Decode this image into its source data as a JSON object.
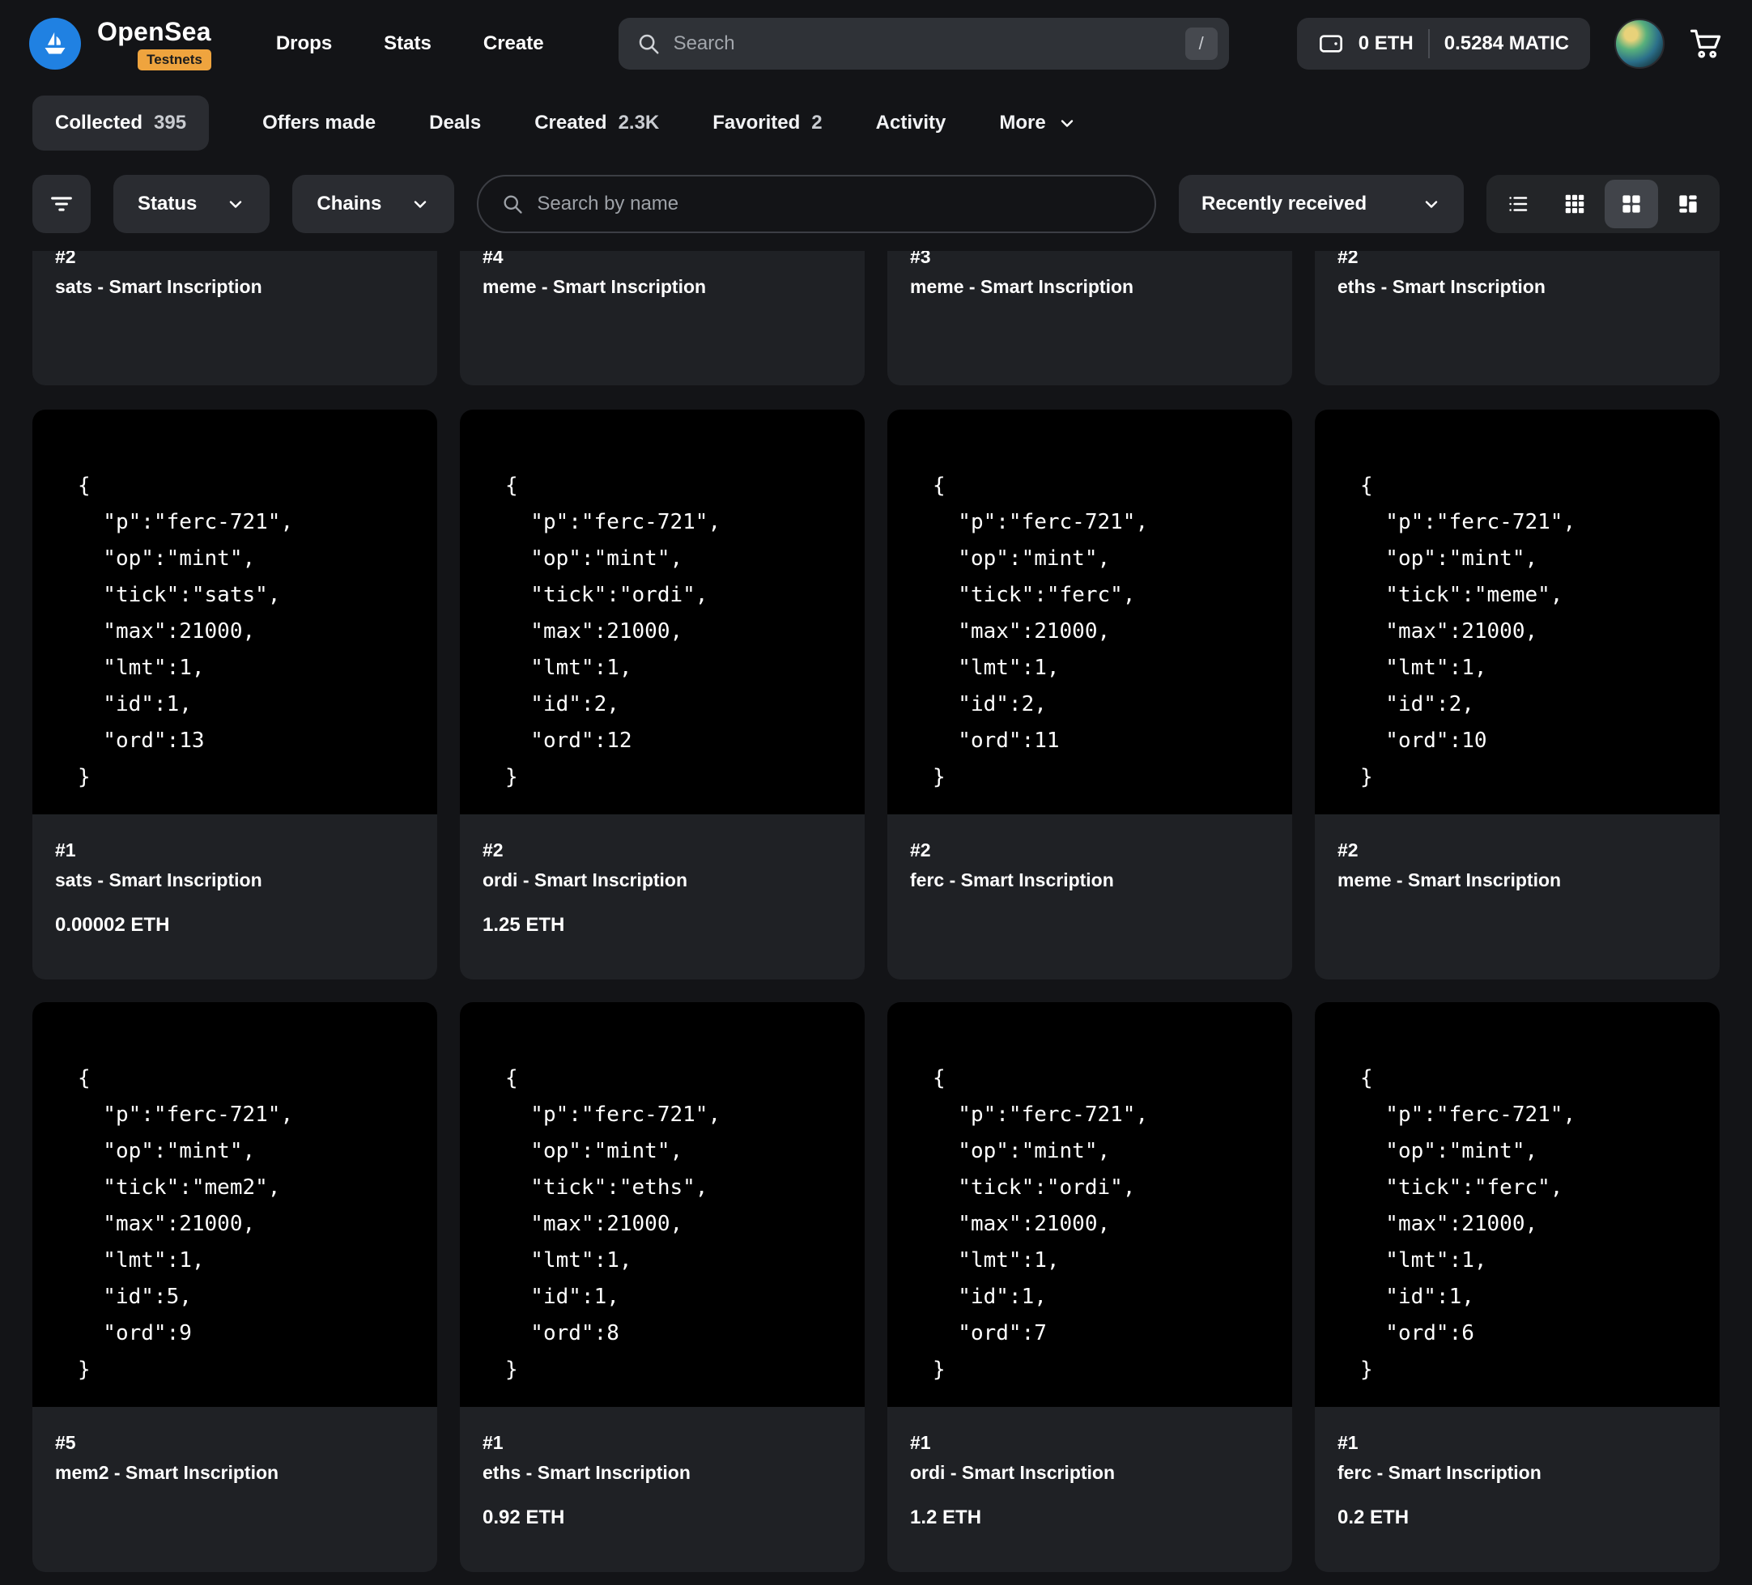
{
  "header": {
    "brand": "OpenSea",
    "badge": "Testnets",
    "nav": [
      "Drops",
      "Stats",
      "Create"
    ],
    "search_placeholder": "Search",
    "search_shortcut": "/",
    "wallet": {
      "eth": "0 ETH",
      "matic": "0.5284 MATIC"
    },
    "accent_blue": "#2081e2",
    "badge_orange": "#efa43e"
  },
  "tabs": [
    {
      "label": "Collected",
      "count": "395"
    },
    {
      "label": "Offers made"
    },
    {
      "label": "Deals"
    },
    {
      "label": "Created",
      "count": "2.3K"
    },
    {
      "label": "Favorited",
      "count": "2"
    },
    {
      "label": "Activity"
    },
    {
      "label": "More"
    }
  ],
  "filters": {
    "status_label": "Status",
    "chains_label": "Chains",
    "search_placeholder": "Search by name",
    "sort_label": "Recently received"
  },
  "cards": {
    "partial": [
      {
        "number": "#2",
        "name": "sats - Smart Inscription"
      },
      {
        "number": "#4",
        "name": "meme - Smart Inscription"
      },
      {
        "number": "#3",
        "name": "meme - Smart Inscription"
      },
      {
        "number": "#2",
        "name": "eths - Smart Inscription"
      }
    ],
    "full": [
      {
        "code": [
          "{",
          "  \"p\":\"ferc-721\",",
          "  \"op\":\"mint\",",
          "  \"tick\":\"sats\",",
          "  \"max\":21000,",
          "  \"lmt\":1,",
          "  \"id\":1,",
          "  \"ord\":13",
          "}"
        ],
        "number": "#1",
        "name": "sats - Smart Inscription",
        "price": "0.00002 ETH"
      },
      {
        "code": [
          "{",
          "  \"p\":\"ferc-721\",",
          "  \"op\":\"mint\",",
          "  \"tick\":\"ordi\",",
          "  \"max\":21000,",
          "  \"lmt\":1,",
          "  \"id\":2,",
          "  \"ord\":12",
          "}"
        ],
        "number": "#2",
        "name": "ordi - Smart Inscription",
        "price": "1.25 ETH"
      },
      {
        "code": [
          "{",
          "  \"p\":\"ferc-721\",",
          "  \"op\":\"mint\",",
          "  \"tick\":\"ferc\",",
          "  \"max\":21000,",
          "  \"lmt\":1,",
          "  \"id\":2,",
          "  \"ord\":11",
          "}"
        ],
        "number": "#2",
        "name": "ferc - Smart Inscription",
        "price": ""
      },
      {
        "code": [
          "{",
          "  \"p\":\"ferc-721\",",
          "  \"op\":\"mint\",",
          "  \"tick\":\"meme\",",
          "  \"max\":21000,",
          "  \"lmt\":1,",
          "  \"id\":2,",
          "  \"ord\":10",
          "}"
        ],
        "number": "#2",
        "name": "meme - Smart Inscription",
        "price": ""
      },
      {
        "code": [
          "{",
          "  \"p\":\"ferc-721\",",
          "  \"op\":\"mint\",",
          "  \"tick\":\"mem2\",",
          "  \"max\":21000,",
          "  \"lmt\":1,",
          "  \"id\":5,",
          "  \"ord\":9",
          "}"
        ],
        "number": "#5",
        "name": "mem2 - Smart Inscription",
        "price": ""
      },
      {
        "code": [
          "{",
          "  \"p\":\"ferc-721\",",
          "  \"op\":\"mint\",",
          "  \"tick\":\"eths\",",
          "  \"max\":21000,",
          "  \"lmt\":1,",
          "  \"id\":1,",
          "  \"ord\":8",
          "}"
        ],
        "number": "#1",
        "name": "eths - Smart Inscription",
        "price": "0.92 ETH"
      },
      {
        "code": [
          "{",
          "  \"p\":\"ferc-721\",",
          "  \"op\":\"mint\",",
          "  \"tick\":\"ordi\",",
          "  \"max\":21000,",
          "  \"lmt\":1,",
          "  \"id\":1,",
          "  \"ord\":7",
          "}"
        ],
        "number": "#1",
        "name": "ordi - Smart Inscription",
        "price": "1.2 ETH"
      },
      {
        "code": [
          "{",
          "  \"p\":\"ferc-721\",",
          "  \"op\":\"mint\",",
          "  \"tick\":\"ferc\",",
          "  \"max\":21000,",
          "  \"lmt\":1,",
          "  \"id\":1,",
          "  \"ord\":6",
          "}"
        ],
        "number": "#1",
        "name": "ferc - Smart Inscription",
        "price": "0.2 ETH"
      }
    ]
  }
}
